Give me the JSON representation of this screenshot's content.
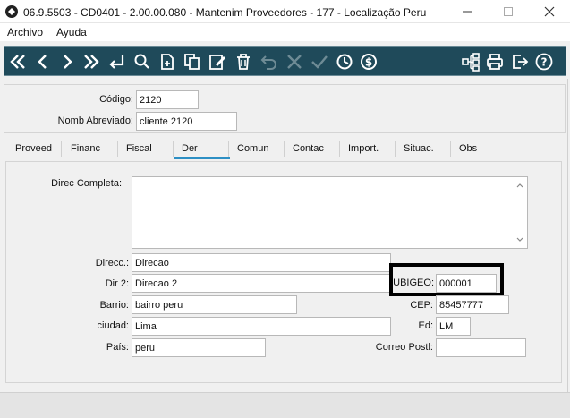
{
  "window": {
    "title": "06.9.5503 - CD0401 - 2.00.00.080 - Mantenim Proveedores - 177 - Localização Peru",
    "minimize_icon": "minimize-icon",
    "maximize_icon": "maximize-icon",
    "close_icon": "close-icon"
  },
  "menu": {
    "items": [
      {
        "label": "Archivo"
      },
      {
        "label": "Ayuda"
      }
    ]
  },
  "toolbar": {
    "background": "#1f4a5a",
    "buttons": [
      "first-icon",
      "previous-icon",
      "next-icon",
      "last-icon",
      "enter-icon",
      "search-icon",
      "new-icon",
      "copy-icon",
      "edit-icon",
      "delete-icon",
      "undo-icon",
      "cancel-icon",
      "confirm-icon",
      "history-icon",
      "currency-icon",
      "structure-icon",
      "print-icon",
      "exit-icon",
      "help-icon"
    ]
  },
  "header": {
    "codigo_label": "Código:",
    "codigo_value": "2120",
    "nomb_label": "Nomb Abreviado:",
    "nomb_value": "cliente 2120"
  },
  "tabs": [
    {
      "label": "Proveed"
    },
    {
      "label": "Financ"
    },
    {
      "label": "Fiscal"
    },
    {
      "label": "Der"
    },
    {
      "label": "Comun"
    },
    {
      "label": "Contac"
    },
    {
      "label": "Import."
    },
    {
      "label": "Situac."
    },
    {
      "label": "Obs"
    }
  ],
  "active_tab": "Der",
  "accent_color": "#2d8fc4",
  "form": {
    "direc_completa_label": "Direc Completa:",
    "direc_completa_value": "",
    "direcc_label": "Direcc.:",
    "direcc_value": "Direcao",
    "dir2_label": "Dir 2:",
    "dir2_value": "Direcao 2",
    "ubigeo_label": "UBIGEO:",
    "ubigeo_value": "000001",
    "barrio_label": "Barrio:",
    "barrio_value": "bairro peru",
    "cep_label": "CEP:",
    "cep_value": "85457777",
    "ciudad_label": "ciudad:",
    "ciudad_value": "Lima",
    "ed_label": "Ed:",
    "ed_value": "LM",
    "pais_label": "País:",
    "pais_value": "peru",
    "correo_label": "Correo Postl:",
    "correo_value": ""
  }
}
